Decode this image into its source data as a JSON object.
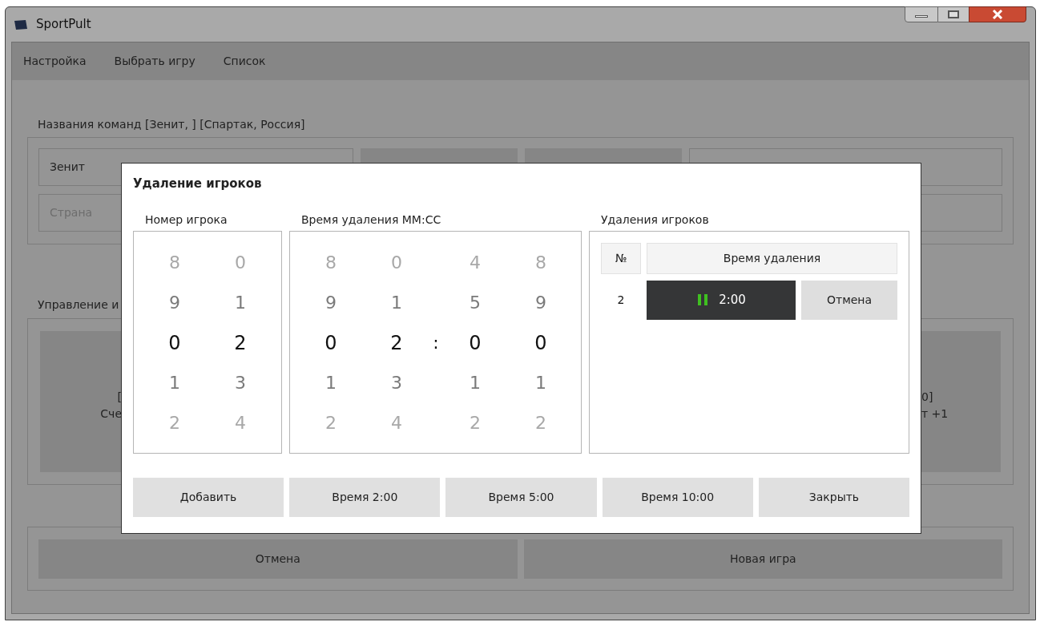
{
  "window": {
    "title": "SportPult"
  },
  "menu": [
    "Настройка",
    "Выбрать игру",
    "Список"
  ],
  "teams": {
    "label": "Названия команд [Зенит, ] [Спартак, Россия]",
    "name_value": "Зенит",
    "country_placeholder": "Страна"
  },
  "control": {
    "label": "Управление и",
    "left_button": [
      "[",
      "Сче"
    ],
    "right_button": [
      "0]",
      "т +1"
    ]
  },
  "footer_buttons": [
    "Отмена",
    "Новая игра"
  ],
  "dialog": {
    "title": "Удаление игроков",
    "player_label": "Номер игрока",
    "player_columns": [
      {
        "items": [
          {
            "text": "8",
            "selected": false
          },
          {
            "text": "9",
            "selected": false
          },
          {
            "text": "0",
            "selected": true
          },
          {
            "text": "1",
            "selected": false
          },
          {
            "text": "2",
            "selected": false
          }
        ]
      },
      {
        "items": [
          {
            "text": "0",
            "selected": false
          },
          {
            "text": "1",
            "selected": false
          },
          {
            "text": "2",
            "selected": true
          },
          {
            "text": "3",
            "selected": false
          },
          {
            "text": "4",
            "selected": false
          }
        ]
      }
    ],
    "time_label": "Время удаления ММ:СС",
    "time_separator": ":",
    "time_columns": [
      {
        "items": [
          {
            "text": "8",
            "selected": false
          },
          {
            "text": "9",
            "selected": false
          },
          {
            "text": "0",
            "selected": true
          },
          {
            "text": "1",
            "selected": false
          },
          {
            "text": "2",
            "selected": false
          }
        ]
      },
      {
        "items": [
          {
            "text": "0",
            "selected": false
          },
          {
            "text": "1",
            "selected": false
          },
          {
            "text": "2",
            "selected": true
          },
          {
            "text": "3",
            "selected": false
          },
          {
            "text": "4",
            "selected": false
          }
        ]
      },
      {
        "items": [
          {
            "text": "4",
            "selected": false
          },
          {
            "text": "5",
            "selected": false
          },
          {
            "text": "0",
            "selected": true
          },
          {
            "text": "1",
            "selected": false
          },
          {
            "text": "2",
            "selected": false
          }
        ]
      },
      {
        "items": [
          {
            "text": "8",
            "selected": false
          },
          {
            "text": "9",
            "selected": false
          },
          {
            "text": "0",
            "selected": true
          },
          {
            "text": "1",
            "selected": false
          },
          {
            "text": "2",
            "selected": false
          }
        ]
      }
    ],
    "penalties_label": "Удаления игроков",
    "penalties_columns": [
      "№",
      "Время удаления"
    ],
    "penalties": [
      {
        "number": "2",
        "time": "2:00",
        "cancel": "Отмена"
      }
    ],
    "buttons": [
      "Добавить",
      "Время 2:00",
      "Время 5:00",
      "Время 10:00",
      "Закрыть"
    ]
  }
}
